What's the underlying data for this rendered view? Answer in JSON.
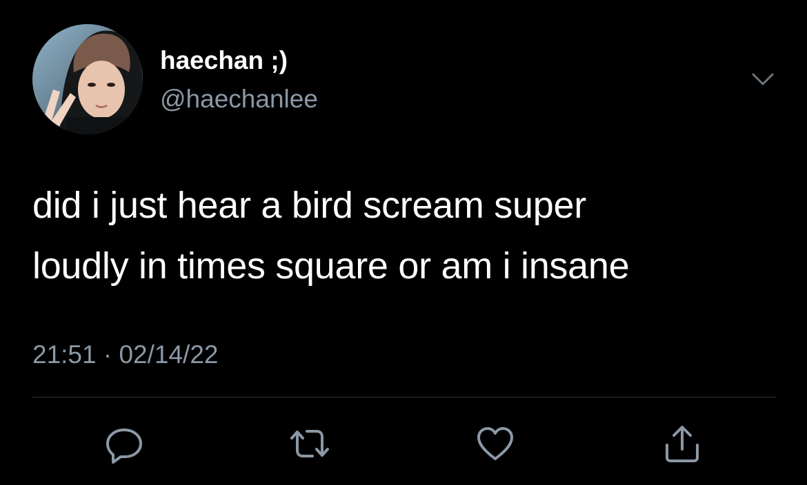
{
  "tweet": {
    "author": {
      "display_name": "haechan ;)",
      "handle": "@haechanlee"
    },
    "text_lines": [
      "did i just hear a bird scream super",
      "loudly in times square or am i insane"
    ],
    "timestamp": "21:51 · 02/14/22",
    "actions": [
      "reply-icon",
      "retweet-icon",
      "like-icon",
      "share-icon"
    ],
    "colors": {
      "background": "#000000",
      "primary_text": "#ffffff",
      "secondary_text": "#8b98a5",
      "divider": "#2f3336"
    }
  }
}
